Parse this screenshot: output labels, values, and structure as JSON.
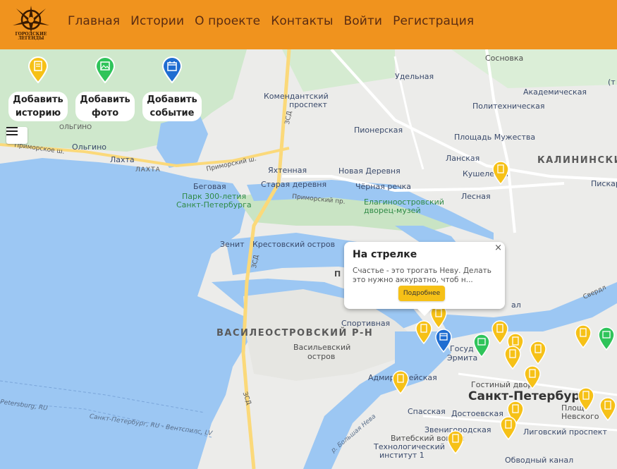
{
  "header": {
    "logo_text_1": "ГОРОДСКИЕ",
    "logo_text_2": "ЛЕГЕНДЫ",
    "nav": [
      {
        "label": "Главная"
      },
      {
        "label": "Истории"
      },
      {
        "label": "О проекте"
      },
      {
        "label": "Контакты"
      },
      {
        "label": "Войти"
      },
      {
        "label": "Регистрация"
      }
    ]
  },
  "add_buttons": [
    {
      "label_1": "Добавить",
      "label_2": "историю",
      "icon": "book-icon",
      "color": "#f6c117"
    },
    {
      "label_1": "Добавить",
      "label_2": "фото",
      "icon": "photo-icon",
      "color": "#2fc45a"
    },
    {
      "label_1": "Добавить",
      "label_2": "событие",
      "icon": "calendar-icon",
      "color": "#1f6dd1"
    }
  ],
  "popup": {
    "title": "На стрелке",
    "text": "Счастье - это трогать Неву. Делать это нужно аккуратно, чтоб н...",
    "button": "Подробнее",
    "close": "×"
  },
  "map_labels": {
    "sosnovka": "Сосновка",
    "udelnaya": "Удельная",
    "akadem": "Академическая",
    "komendant": "Комендантский",
    "prospekt": "проспект",
    "polytech": "Политехническая",
    "pionerskaya": "Пионерская",
    "ploshchad_muzhestva": "Площадь Мужества",
    "kalininsky": "КАЛИНИНСКИЙ",
    "lanskaya": "Ланская",
    "kushelevka": "Кушелевка",
    "piskar": "Пискар",
    "olgino_top": "ОЛЬГИНО",
    "olgino": "Ольгино",
    "primorskoe_sh": "Приморское ш.",
    "lakhta": "Лахта",
    "lakhta_caps": "ЛАХТА",
    "primorsky_sh": "Приморский ш.",
    "yakhtennaya": "Яхтенная",
    "novaya_derevnya": "Новая Деревня",
    "begovaya": "Беговая",
    "staraya_derevnya": "Старая деревня",
    "chernaya_rechka": "Чёрная речка",
    "lesnaya": "Лесная",
    "park_300_1": "Парк 300-летия",
    "park_300_2": "Санкт-Петербурга",
    "primorsky_pr": "Приморский пр.",
    "elagin_1": "Елагиноостровский",
    "elagin_2": "дворец-музей",
    "zenit": "Зенит",
    "krestovsky": "Крестовский остров",
    "zsd_1": "ЗСД",
    "zsd_2": "ЗСД",
    "zsd_3": "ЗСД",
    "vasileostrovsky": "ВАСИЛЕОСТРОВСКИЙ Р-Н",
    "sportivnaya": "Спортивная",
    "vasilievsky_1": "Васильевский",
    "vasilievsky_2": "остров",
    "gos_1": "Госуд",
    "gos_2": "Эрмита",
    "admiralteyskaya": "Адмиралтейская",
    "gostiny": "Гостиный двор",
    "spb": "Санкт-Петербург",
    "spasskaya": "Спасская",
    "dostoevskaya": "Достоевская",
    "ploshchad": "Площ",
    "nevsky": "Невского",
    "zvenigorodskaya": "Звенигородская",
    "vitebsky_1": "Витебский вокзал",
    "tech_1": "Технологический",
    "tech_2": "институт 1",
    "ligovsky": "Лиговский проспект",
    "obvodny": "Обводный канал",
    "bolshaya_neva": "р. Большая Нева",
    "fairway_1": "Petersburg, RU",
    "fairway_2": "Санкт-Петербург, RU - Вентспилс, LV",
    "sverdlovskaya": "Свердл",
    "pi": "П",
    "al": "ал",
    "t_paren": "(т"
  }
}
